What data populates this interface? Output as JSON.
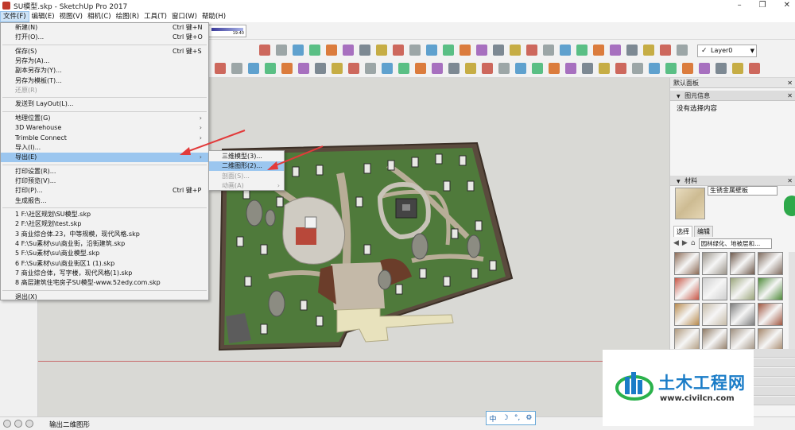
{
  "window": {
    "title": "SU模型.skp - SketchUp Pro 2017",
    "controls": [
      "–",
      "❐",
      "✕"
    ]
  },
  "menubar": [
    {
      "label": "文件(F)",
      "active": true
    },
    {
      "label": "编辑(E)"
    },
    {
      "label": "视图(V)"
    },
    {
      "label": "相机(C)"
    },
    {
      "label": "绘图(R)"
    },
    {
      "label": "工具(T)"
    },
    {
      "label": "窗口(W)"
    },
    {
      "label": "帮助(H)"
    }
  ],
  "toolbar": {
    "time_label": "19:40",
    "layer": "Layer0"
  },
  "file_menu": {
    "items": [
      {
        "label": "新建(N)",
        "shortcut": "Ctrl 键+N"
      },
      {
        "label": "打开(O)...",
        "shortcut": "Ctrl 键+O"
      },
      {
        "sep": true
      },
      {
        "label": "保存(S)",
        "shortcut": "Ctrl 键+S"
      },
      {
        "label": "另存为(A)..."
      },
      {
        "label": "副本另存为(Y)..."
      },
      {
        "label": "另存为模板(T)..."
      },
      {
        "label": "还原(R)",
        "disabled": true
      },
      {
        "sep": true
      },
      {
        "label": "发送到 LayOut(L)..."
      },
      {
        "sep": true
      },
      {
        "label": "地理位置(G)",
        "submenu": true
      },
      {
        "label": "3D Warehouse",
        "submenu": true
      },
      {
        "label": "Trimble Connect",
        "submenu": true
      },
      {
        "label": "导入(I)..."
      },
      {
        "label": "导出(E)",
        "submenu": true,
        "highlight": true
      },
      {
        "sep": true
      },
      {
        "label": "打印设置(R)..."
      },
      {
        "label": "打印预览(V)..."
      },
      {
        "label": "打印(P)...",
        "shortcut": "Ctrl 键+P"
      },
      {
        "label": "生成报告..."
      },
      {
        "sep": true
      },
      {
        "label": "1 F:\\社区规划\\SU模型.skp"
      },
      {
        "label": "2 F:\\社区规划\\test.skp"
      },
      {
        "label": "3 商业综合体.23，中等规模，现代风格.skp"
      },
      {
        "label": "4 F:\\Su素材\\su\\商业街，沿街建筑.skp"
      },
      {
        "label": "5 F:\\Su素材\\su\\商业模型.skp"
      },
      {
        "label": "6 F:\\Su素材\\su\\商业街区1 (1).skp"
      },
      {
        "label": "7 商业综合体，写字楼，现代风格(1).skp"
      },
      {
        "label": "8 高层建筑住宅房子SU模型-www.52edy.com.skp"
      },
      {
        "sep": true
      },
      {
        "label": "退出(X)"
      }
    ]
  },
  "export_menu": {
    "items": [
      {
        "label": "三维模型(3)..."
      },
      {
        "label": "二维图形(2)...",
        "highlight": true
      },
      {
        "label": "剖面(S)...",
        "disabled": true
      },
      {
        "label": "动画(A)",
        "disabled": true,
        "submenu": true
      }
    ]
  },
  "right_panel": {
    "tray_title": "默认面板",
    "entity_info_title": "图元信息",
    "entity_info_value": "没有选择内容",
    "materials_title": "材料",
    "material_name": "生锈金属壁板",
    "tabs": [
      "选择",
      "编辑"
    ],
    "category": "园林绿化、地被层和..."
  },
  "status": {
    "text": "输出二维图形"
  },
  "ime": [
    "中",
    "☽",
    "°,",
    "⚙"
  ],
  "watermark": {
    "title": "土木工程网",
    "url": "www.civilcn.com"
  },
  "colors": {
    "menu_highlight": "#9bc6ef",
    "canvas_bg": "#d9d9d5",
    "grass": "#4e7a3a",
    "watermark_blue": "#1a7cc7"
  },
  "material_swatches": [
    "#8b6a55",
    "#9b948a",
    "#6f5a4c",
    "#7f6b5e",
    "#c95646",
    "#cfcfcf",
    "#9aa57a",
    "#4f8b3a",
    "#b88a4c",
    "#c7bca8",
    "#7c7c7c",
    "#a0553f",
    "#b09a7e",
    "#8f7a64",
    "#9e8f7e",
    "#a5886b"
  ]
}
